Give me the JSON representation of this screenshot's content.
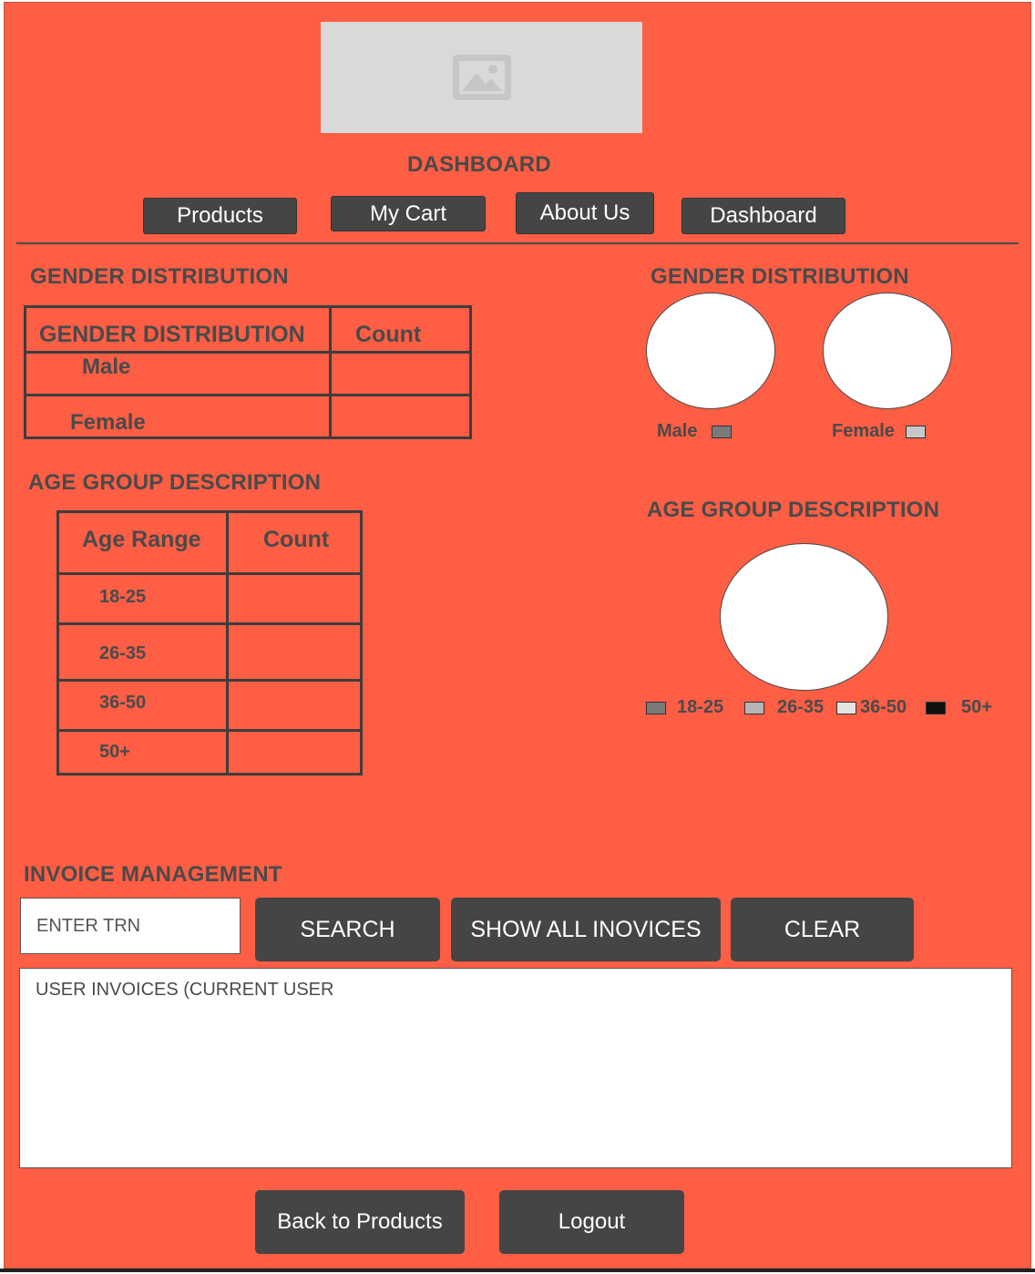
{
  "header": {
    "logo_icon": "image-placeholder-icon",
    "title": "DASHBOARD"
  },
  "nav": {
    "products": "Products",
    "my_cart": "My Cart",
    "about_us": "About Us",
    "dashboard": "Dashboard"
  },
  "gender_table": {
    "section_title": "GENDER DISTRIBUTION",
    "columns": [
      "GENDER DISTRIBUTION",
      "Count"
    ],
    "rows": [
      {
        "label": "Male",
        "count": ""
      },
      {
        "label": "Female",
        "count": ""
      }
    ]
  },
  "gender_chart": {
    "section_title": "GENDER DISTRIBUTION",
    "legend": [
      {
        "label": "Male",
        "color": "#7a7a7a"
      },
      {
        "label": "Female",
        "color": "#c8c8c8"
      }
    ]
  },
  "age_table": {
    "section_title": "AGE GROUP DESCRIPTION",
    "columns": [
      "Age Range",
      "Count"
    ],
    "rows": [
      {
        "label": "18-25",
        "count": ""
      },
      {
        "label": "26-35",
        "count": ""
      },
      {
        "label": "36-50",
        "count": ""
      },
      {
        "label": "50+",
        "count": ""
      }
    ]
  },
  "age_chart": {
    "section_title": "AGE GROUP DESCRIPTION",
    "legend": [
      {
        "label": "18-25",
        "color": "#7a7a7a"
      },
      {
        "label": "26-35",
        "color": "#b5b5b5"
      },
      {
        "label": "36-50",
        "color": "#e3e3e3"
      },
      {
        "label": "50+",
        "color": "#111111"
      }
    ]
  },
  "invoice": {
    "section_title": "INVOICE MANAGEMENT",
    "trn_placeholder": "ENTER TRN",
    "search_label": "SEARCH",
    "show_all_label": "SHOW ALL INOVICES",
    "clear_label": "CLEAR",
    "results_text": "USER INVOICES (CURRENT USER"
  },
  "footer": {
    "back_label": "Back to Products",
    "logout_label": "Logout"
  },
  "colors": {
    "background": "#fd5e44",
    "button": "#454545",
    "text": "#4a4a4a"
  }
}
